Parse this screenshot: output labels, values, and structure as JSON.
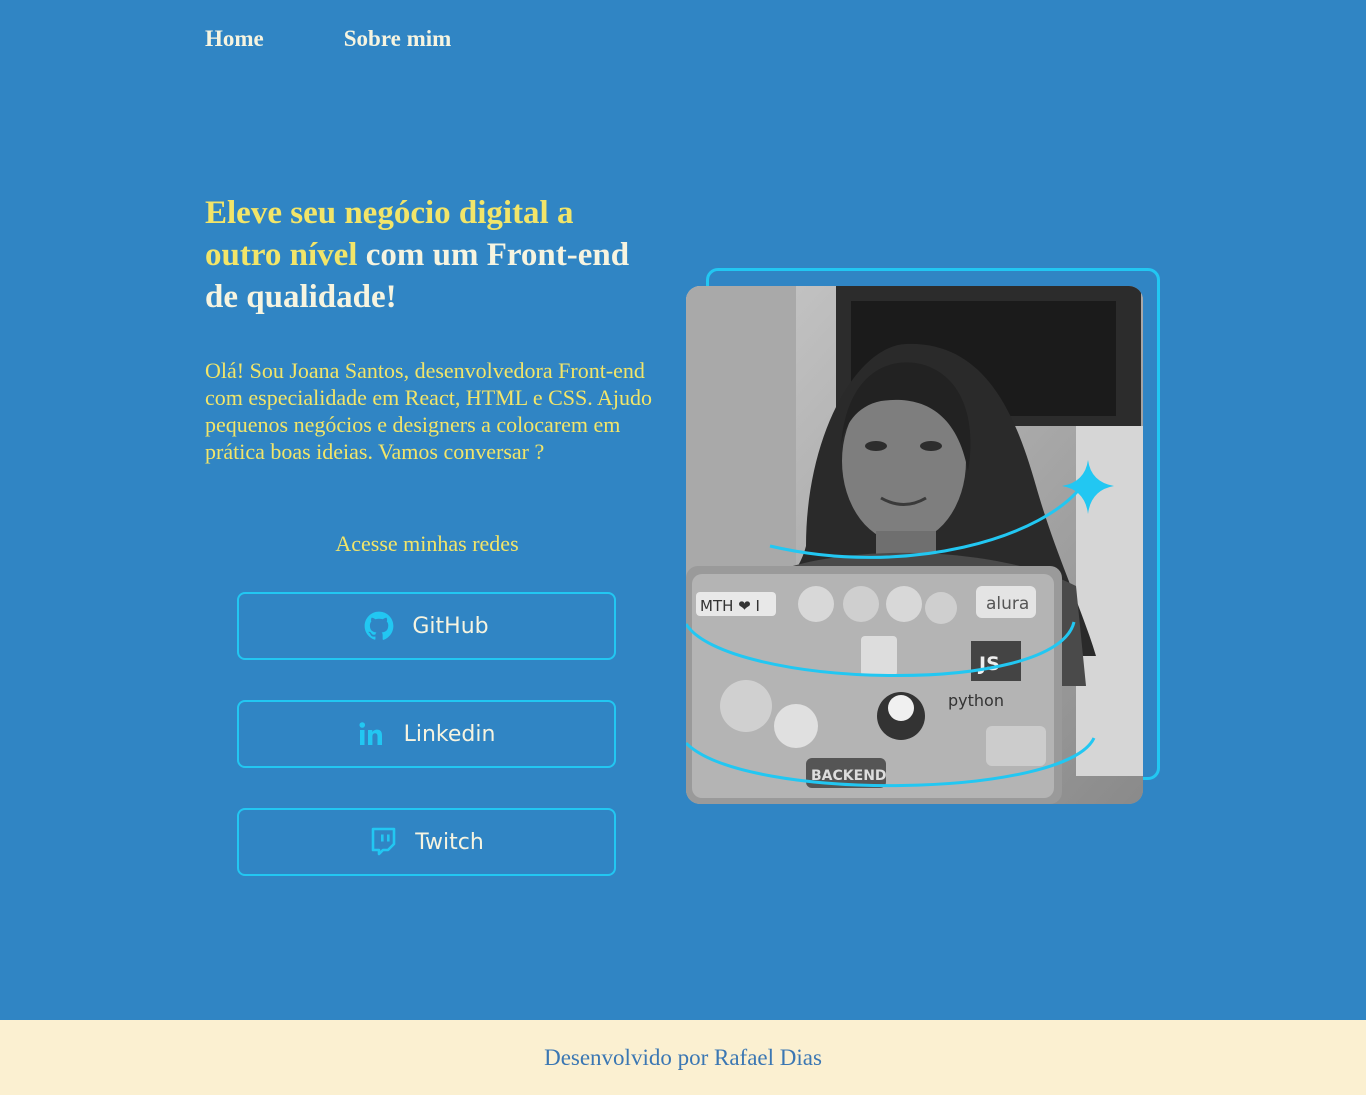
{
  "nav": {
    "items": [
      {
        "label": "Home"
      },
      {
        "label": "Sobre mim"
      }
    ]
  },
  "hero": {
    "headline_highlight": "Eleve seu negócio digital a outro nível",
    "headline_rest": " com um Front-end de qualidade!",
    "intro": "Olá! Sou Joana Santos, desenvolvedora Front-end com especialidade em React, HTML e CSS. Ajudo pequenos negócios e designers a colocarem em prática boas ideias. Vamos conversar ?"
  },
  "social": {
    "title": "Acesse minhas redes",
    "links": [
      {
        "label": "GitHub",
        "icon": "github-icon"
      },
      {
        "label": "Linkedin",
        "icon": "linkedin-icon"
      },
      {
        "label": "Twitch",
        "icon": "twitch-icon"
      }
    ]
  },
  "photo": {
    "laptop_stickers": [
      "MTH ❤ I",
      "alura",
      "JS",
      "python",
      "BACKEND"
    ]
  },
  "footer": {
    "text": "Desenvolvido por Rafael Dias"
  },
  "colors": {
    "background": "#3085c4",
    "accent_yellow": "#f2e569",
    "accent_cyan": "#22c7f2",
    "footer_bg": "#fbf0d1",
    "footer_text": "#3b77b3"
  }
}
